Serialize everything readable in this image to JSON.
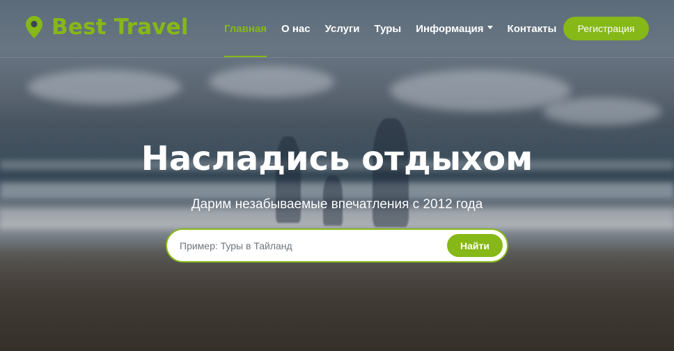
{
  "brand": {
    "name": "Best Travel",
    "icon": "map-marker-icon",
    "color": "#86b817"
  },
  "nav": {
    "items": [
      {
        "label": "Главная",
        "active": true
      },
      {
        "label": "О нас",
        "active": false
      },
      {
        "label": "Услуги",
        "active": false
      },
      {
        "label": "Туры",
        "active": false
      },
      {
        "label": "Информация",
        "active": false,
        "dropdown": true
      },
      {
        "label": "Контакты",
        "active": false
      }
    ],
    "register_label": "Регистрация"
  },
  "hero": {
    "title": "Насладись отдыхом",
    "subtitle": "Дарим незабываемые впечатления с 2012 года"
  },
  "search": {
    "placeholder": "Пример: Туры в Тайланд",
    "button_label": "Найти"
  },
  "colors": {
    "accent": "#86b817"
  }
}
